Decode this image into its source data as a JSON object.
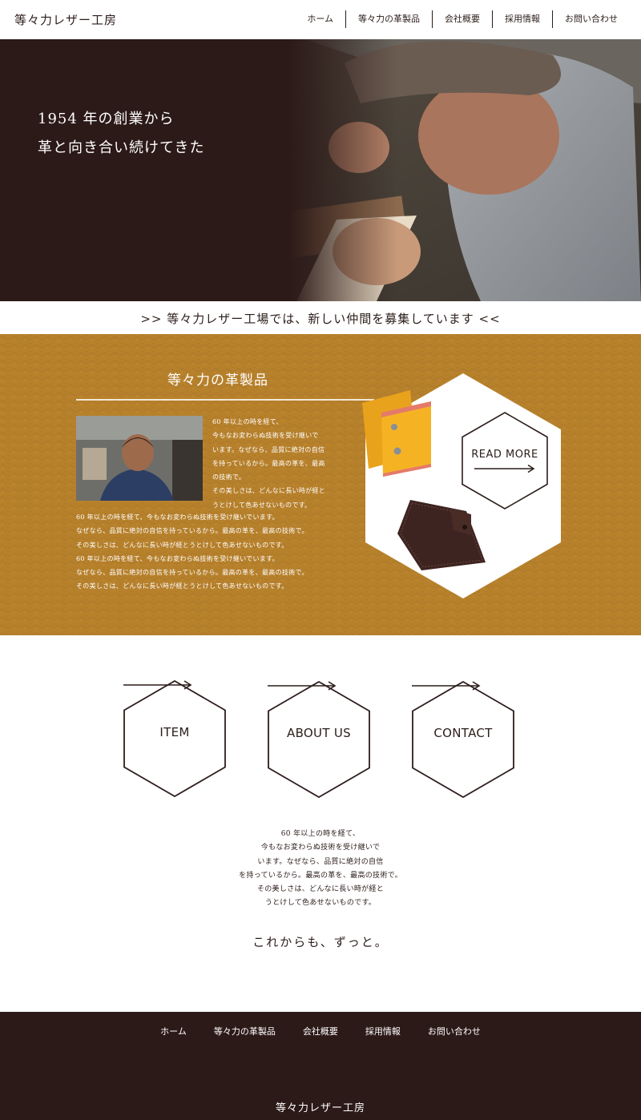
{
  "header": {
    "logo": "等々力レザー工房",
    "nav": [
      "ホーム",
      "等々力の革製品",
      "会社概要",
      "採用情報",
      "お問い合わせ"
    ]
  },
  "hero": {
    "line1": "1954 年の創業から",
    "line2": "革と向き合い続けてきた"
  },
  "recruit_banner": ">> 等々力レザー工場では、新しい仲間を募集しています <<",
  "products": {
    "title": "等々力の革製品",
    "copy_right": [
      "60 年以上の時を経て、",
      "今もなお変わらぬ技術を受け継いで",
      "います。なぜなら、品質に絶対の自信",
      "を持っているから。最高の革を、最高",
      "の技術で。",
      "その美しさは、どんなに長い時が経と",
      "うとけして色あせないものです。"
    ],
    "copy_wide": [
      "60 年以上の時を経て、今もなお変わらぬ技術を受け継いでいます。",
      "なぜなら、品質に絶対の自信を持っているから。最高の革を、最高の技術で。",
      "その美しさは、どんなに長い時が経とうとけして色あせないものです。",
      "60 年以上の時を経て、今もなお変わらぬ技術を受け継いでいます。",
      "なぜなら、品質に絶対の自信を持っているから。最高の革を、最高の技術で。",
      "その美しさは、どんなに長い時が経とうとけして色あせないものです。"
    ],
    "read_more": "READ MORE"
  },
  "hex_nav": [
    "ITEM",
    "ABOUT US",
    "CONTACT"
  ],
  "body_copy": [
    "60 年以上の時を経て、",
    "今もなお変わらぬ技術を受け継いで",
    "います。なぜなら、品質に絶対の自信",
    "を持っているから。最高の革を、最高の技術で。",
    "その美しさは、どんなに長い時が経と",
    "うとけして色あせないものです。"
  ],
  "tagline": "これからも、ずっと。",
  "footer": {
    "nav": [
      "ホーム",
      "等々力の革製品",
      "会社概要",
      "採用情報",
      "お問い合わせ"
    ],
    "logo": "等々力レザー工房"
  },
  "colors": {
    "dark_brown": "#2c1a18",
    "leather": "#b7812c",
    "text": "#2b1d1a",
    "white": "#ffffff"
  }
}
